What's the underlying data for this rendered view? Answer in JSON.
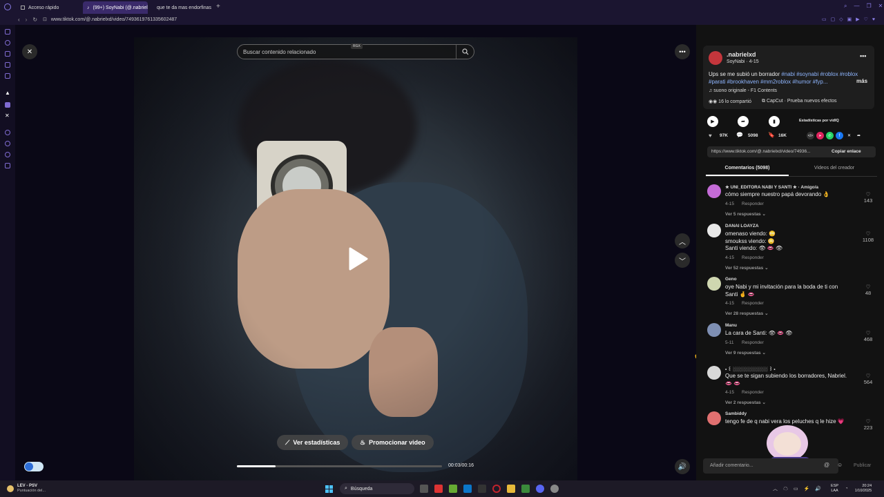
{
  "browser": {
    "tabs": [
      {
        "label": "Acceso rápido",
        "active": false
      },
      {
        "label": "(99+) SoyNabi (@.nabriel",
        "active": true
      },
      {
        "label": "que te da mas endorfinas",
        "active": false
      }
    ],
    "new_tab": "+",
    "url": "www.tiktok.com/@.nabrielxd/video/7493619761335602487"
  },
  "video": {
    "search_placeholder": "Buscar contenido relacionado",
    "badge": "RGX",
    "stats_button": "Ver estadísticas",
    "promote_button": "Promocionar video",
    "time": "00:03/00:16",
    "progress": 0.19
  },
  "author": {
    "username": ".nabrielxd",
    "subline": "SoyNabi · 4-15",
    "caption": "Ups se me subió un borrador",
    "hashtags": "#nabi #soynabi #roblox #roblox #parati #brookhaven #mm2roblox #humor #fyp...",
    "more": "más",
    "sound": "suono originale - F1 Contents",
    "shared": "16 lo compartió",
    "effect": "CapCut · Prueba nuevos efectos",
    "stats_link": "Estadísticas por vidIQ",
    "likes": "97K",
    "comments": "5098",
    "saves": "16K",
    "link": "https://www.tiktok.com/@.nabrielxd/video/74936...",
    "copy_link": "Copiar enlace"
  },
  "panel_tabs": {
    "comments": "Comentarios (5098)",
    "creator_videos": "Videos del creador"
  },
  "comments": [
    {
      "name": "★ UNI_EDITORA NABI Y SANTI ★ · Amigo/a",
      "lines": [
        "cómo siempre nuestro papá devorando 👌"
      ],
      "date": "4-15",
      "reply": "Responder",
      "more": "Ver 5 respuestas",
      "likes": "143",
      "color": "#c46bd6"
    },
    {
      "name": "DANAI LOAYZA",
      "lines": [
        "omenaso viendo: 😳",
        "smoukss viendo: 😳",
        "Santi viendo: 👁 👄 👁"
      ],
      "date": "4-15",
      "reply": "Responder",
      "more": "Ver 52 respuestas",
      "likes": "1108",
      "color": "#e8e8e8"
    },
    {
      "name": "Geno",
      "lines": [
        "oye Nabi y mi invitación para la boda de ti con",
        "Santi 🤞 👄"
      ],
      "date": "4-15",
      "reply": "Responder",
      "more": "Ver 28 respuestas",
      "likes": "48",
      "color": "#cfd7b0"
    },
    {
      "name": "Manu",
      "lines": [
        "La cara de Santi: 👁 👄 👁"
      ],
      "date": "5-11",
      "reply": "Responder",
      "more": "Ver 9 respuestas",
      "likes": "468",
      "color": "#7e8fb3"
    },
    {
      "name": "• ꒰ ░░░░░░░░░░░ ꒱ •",
      "lines": [
        "Que se te sigan subiendo los borradores, Nabriel.",
        "👄 👄"
      ],
      "date": "4-15",
      "reply": "Responder",
      "more": "Ver 2 respuestas",
      "likes": "564",
      "color": "#d8d8d8"
    },
    {
      "name": "Sambiddy",
      "lines": [
        "tengo fe de q nabi vera los peluches q le hize 💗"
      ],
      "date": "",
      "reply": "",
      "more": "",
      "likes": "223",
      "color": "#e07070"
    }
  ],
  "comment_input": {
    "placeholder": "Añadir comentario...",
    "publish": "Publicar"
  },
  "taskbar": {
    "weather_title": "LEV - PSV",
    "weather_sub": "Puntuación del...",
    "search": "Búsqueda",
    "lang": "ESP",
    "lang_sub": "LAA",
    "time": "20:24",
    "date": "1/10/2025"
  }
}
